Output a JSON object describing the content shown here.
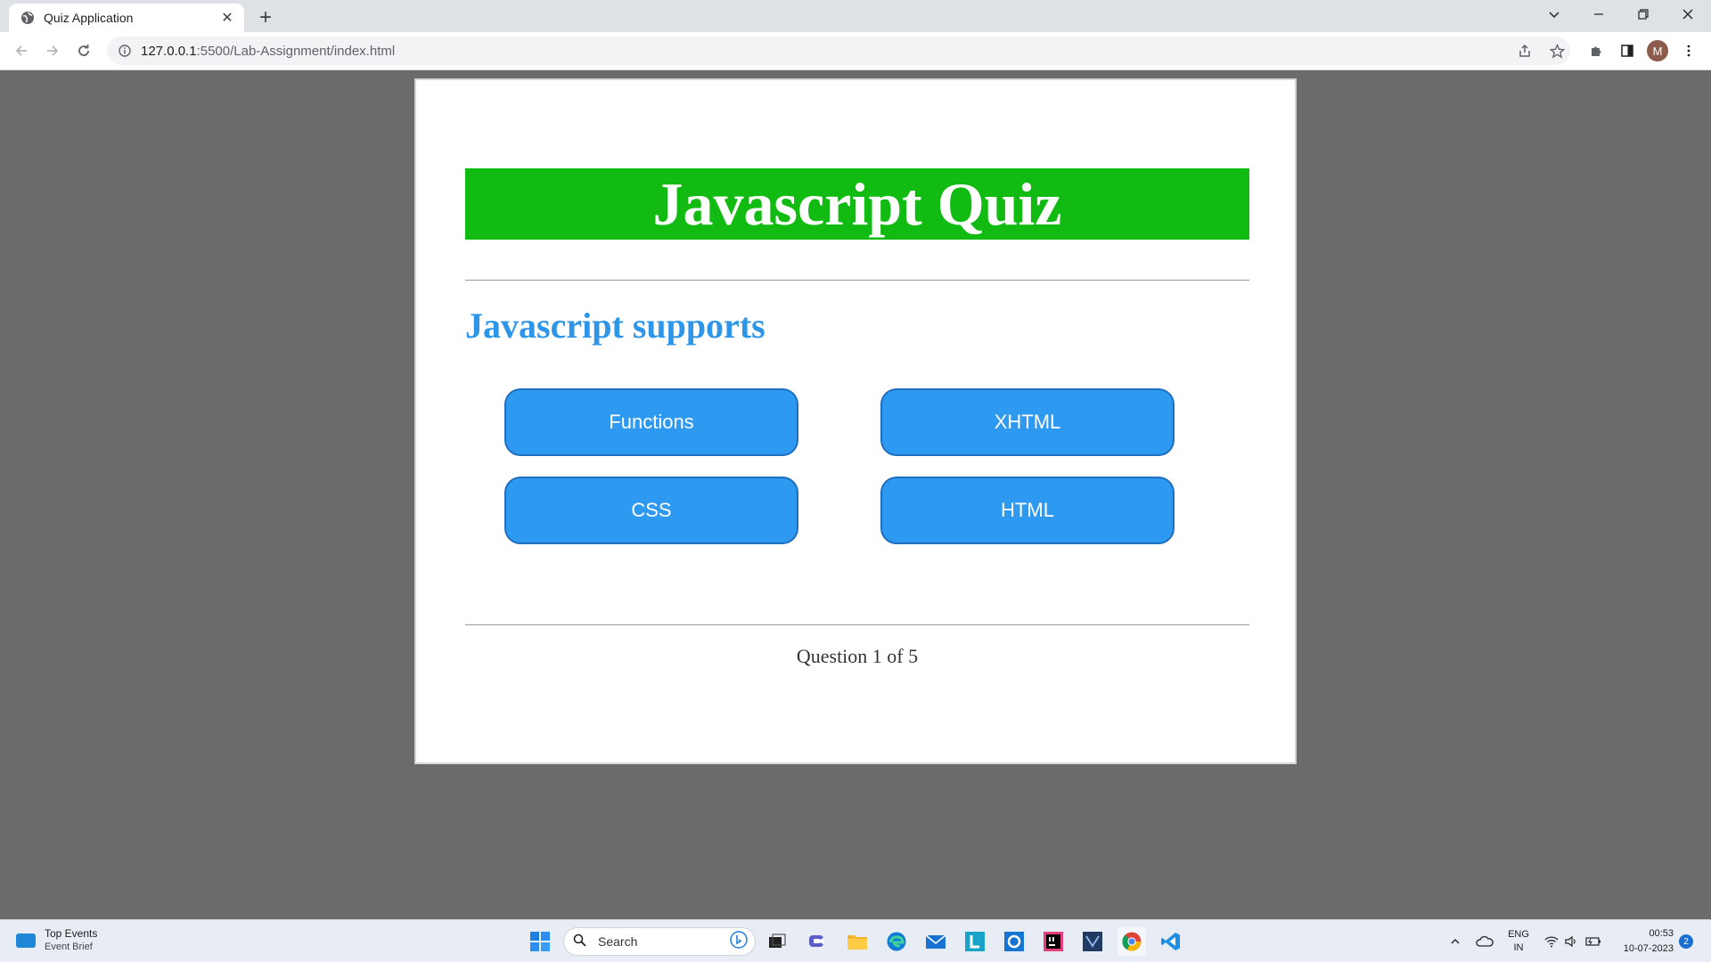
{
  "browser": {
    "tab_title": "Quiz Application",
    "tab_close": "✕",
    "new_tab": "+",
    "url_host": "127.0.0.1",
    "url_rest": ":5500/Lab-Assignment/index.html",
    "avatar_letter": "M"
  },
  "quiz": {
    "title": "Javascript Quiz",
    "question": "Javascript supports",
    "options": [
      "Functions",
      "XHTML",
      "CSS",
      "HTML"
    ],
    "progress_text": "Question 1 of 5",
    "colors": {
      "header_bg": "#12bb12",
      "question_text": "#2e96e8",
      "option_bg": "#2e99f0"
    }
  },
  "taskbar": {
    "widget_title": "Top Events",
    "widget_subtitle": "Event Brief",
    "search_label": "Search",
    "lang_top": "ENG",
    "lang_bottom": "IN",
    "time": "00:53",
    "date": "10-07-2023",
    "notification_count": "2"
  }
}
